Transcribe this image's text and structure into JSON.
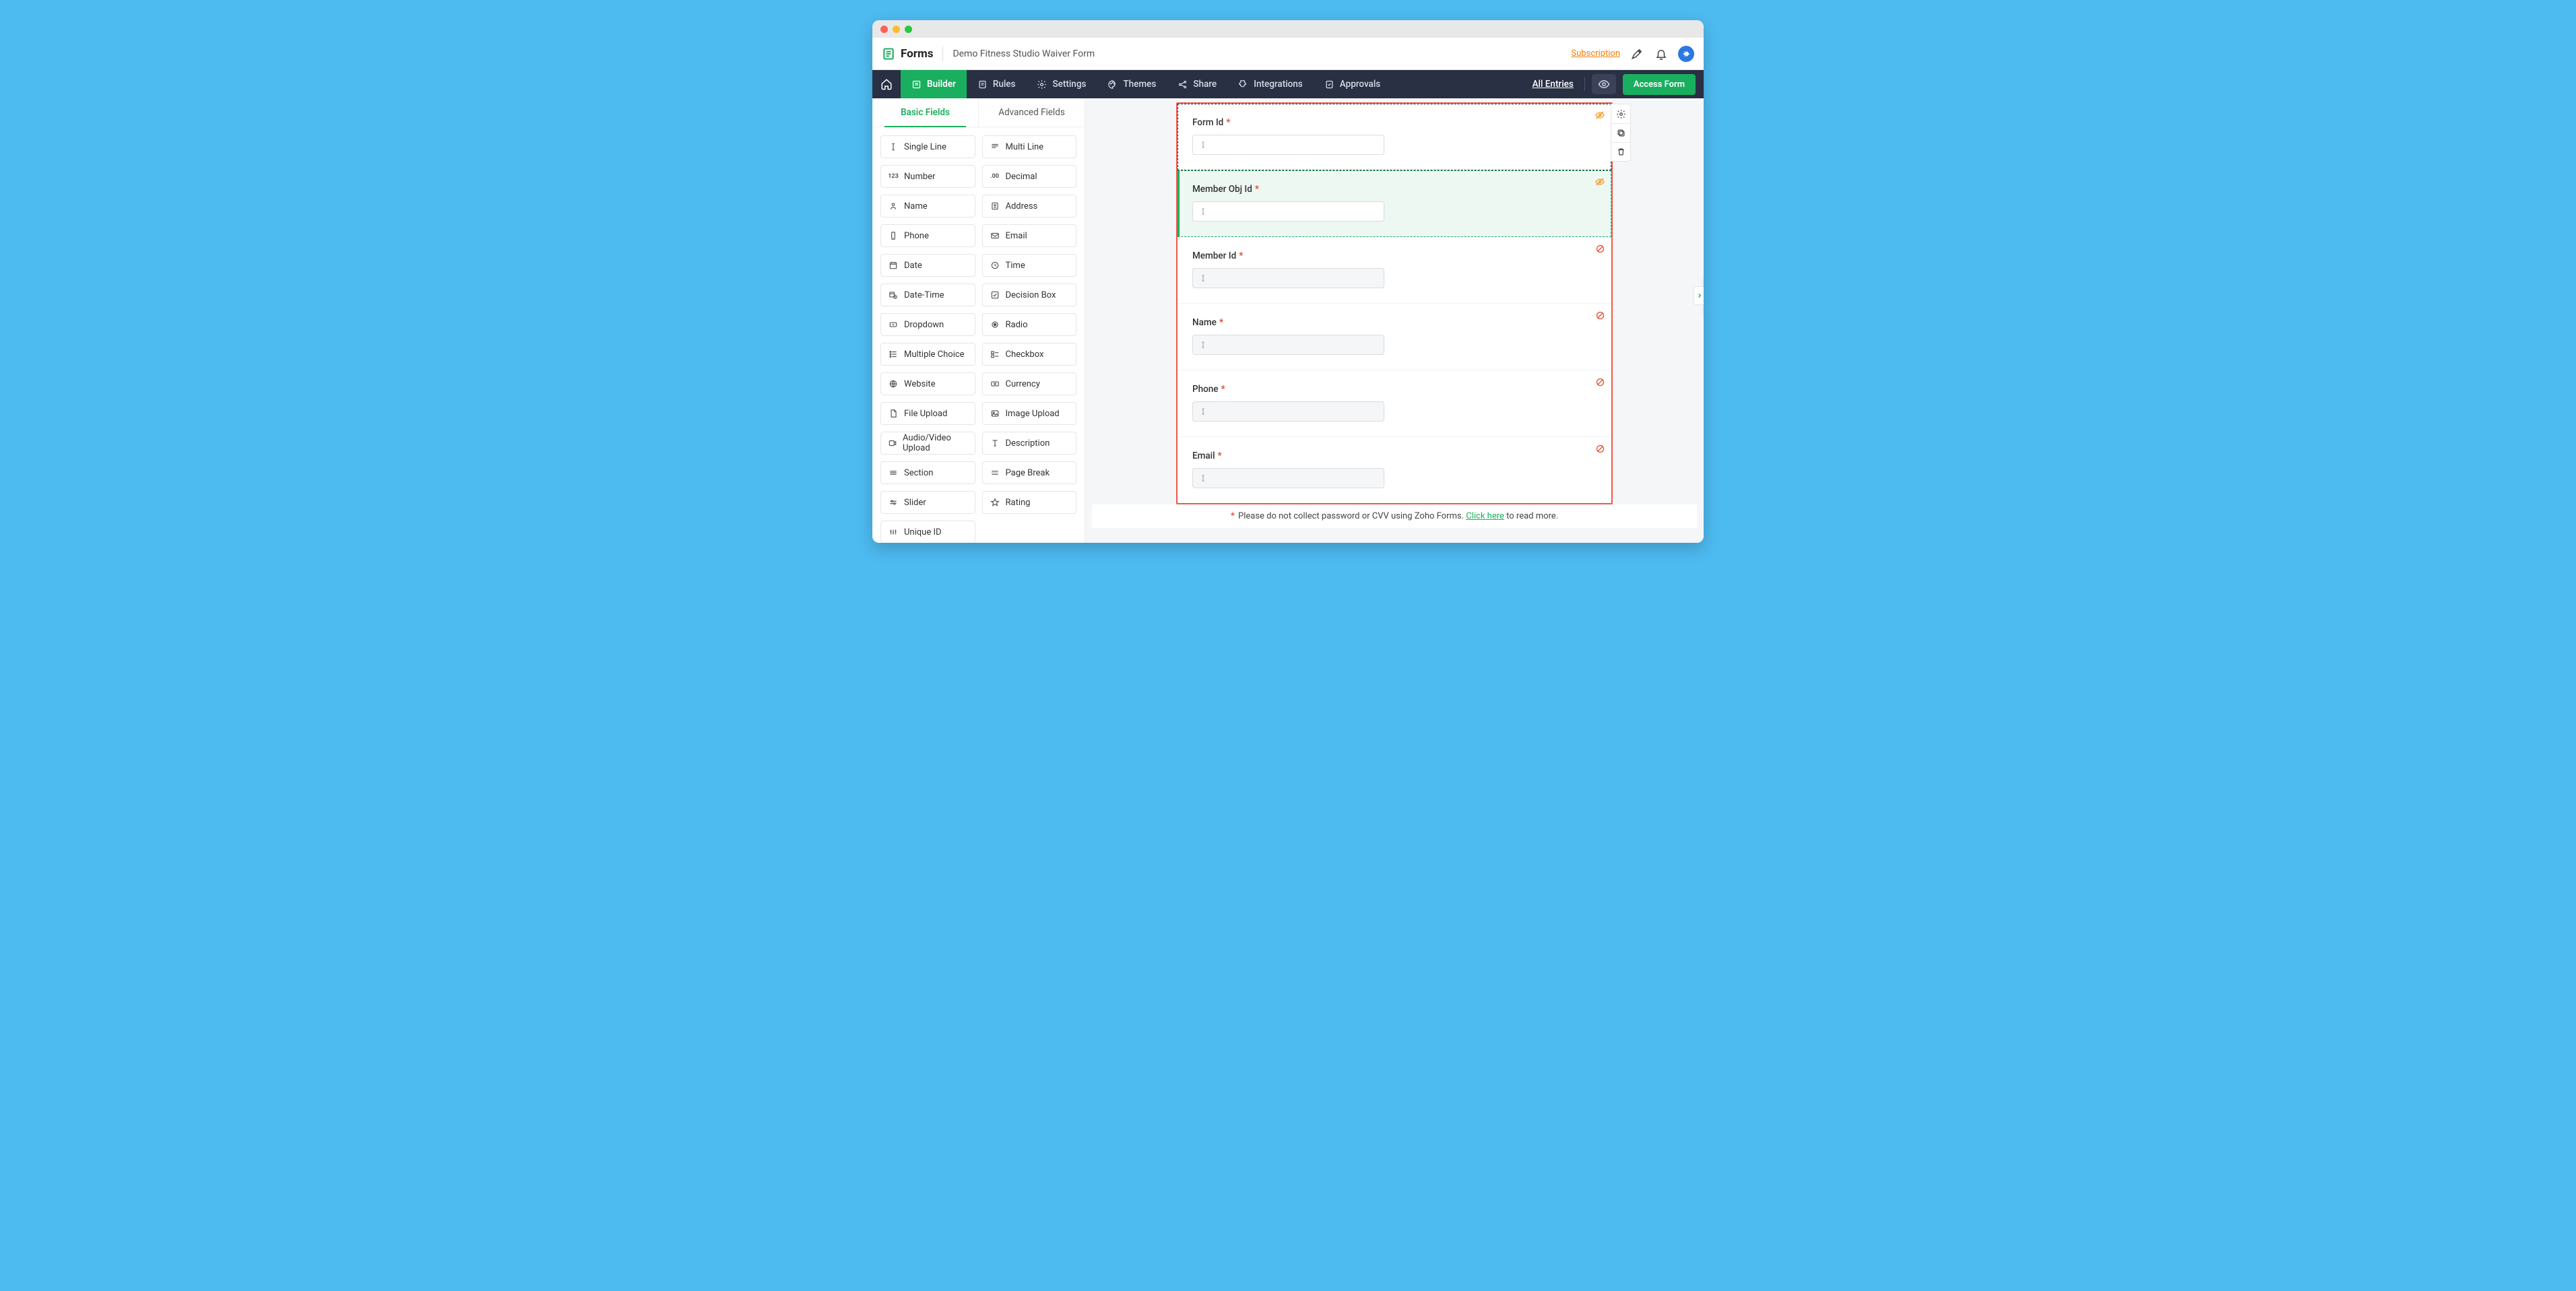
{
  "brand": "Forms",
  "form_title": "Demo Fitness Studio Waiver Form",
  "subscription_label": "Subscription",
  "nav": {
    "builder": "Builder",
    "rules": "Rules",
    "settings": "Settings",
    "themes": "Themes",
    "share": "Share",
    "integrations": "Integrations",
    "approvals": "Approvals",
    "all_entries": "All Entries",
    "access_form": "Access Form"
  },
  "tabs": {
    "basic": "Basic Fields",
    "advanced": "Advanced Fields"
  },
  "fields": {
    "single_line": "Single Line",
    "multi_line": "Multi Line",
    "number": "Number",
    "decimal": "Decimal",
    "name": "Name",
    "address": "Address",
    "phone": "Phone",
    "email": "Email",
    "date": "Date",
    "time": "Time",
    "date_time": "Date-Time",
    "decision_box": "Decision Box",
    "dropdown": "Dropdown",
    "radio": "Radio",
    "multiple_choice": "Multiple Choice",
    "checkbox": "Checkbox",
    "website": "Website",
    "currency": "Currency",
    "file_upload": "File Upload",
    "image_upload": "Image Upload",
    "audio_video_upload": "Audio/Video Upload",
    "description": "Description",
    "section": "Section",
    "page_break": "Page Break",
    "slider": "Slider",
    "rating": "Rating",
    "unique_id": "Unique ID"
  },
  "form_elements": [
    {
      "label": "Form Id",
      "required": true,
      "state": "selected",
      "status_icon": "eye-off",
      "disabled": false
    },
    {
      "label": "Member Obj Id",
      "required": true,
      "state": "hover",
      "status_icon": "eye-off",
      "disabled": false
    },
    {
      "label": "Member Id",
      "required": true,
      "state": "normal",
      "status_icon": "blocked",
      "disabled": true
    },
    {
      "label": "Name",
      "required": true,
      "state": "normal",
      "status_icon": "blocked",
      "disabled": true
    },
    {
      "label": "Phone",
      "required": true,
      "state": "normal",
      "status_icon": "blocked",
      "disabled": true
    },
    {
      "label": "Email",
      "required": true,
      "state": "normal",
      "status_icon": "blocked",
      "disabled": true
    }
  ],
  "footer": {
    "text_before": "Please do not collect password or CVV using Zoho Forms. ",
    "link": "Click here",
    "text_after": " to read more."
  },
  "icons": {
    "number": "123",
    "decimal": ".00"
  }
}
